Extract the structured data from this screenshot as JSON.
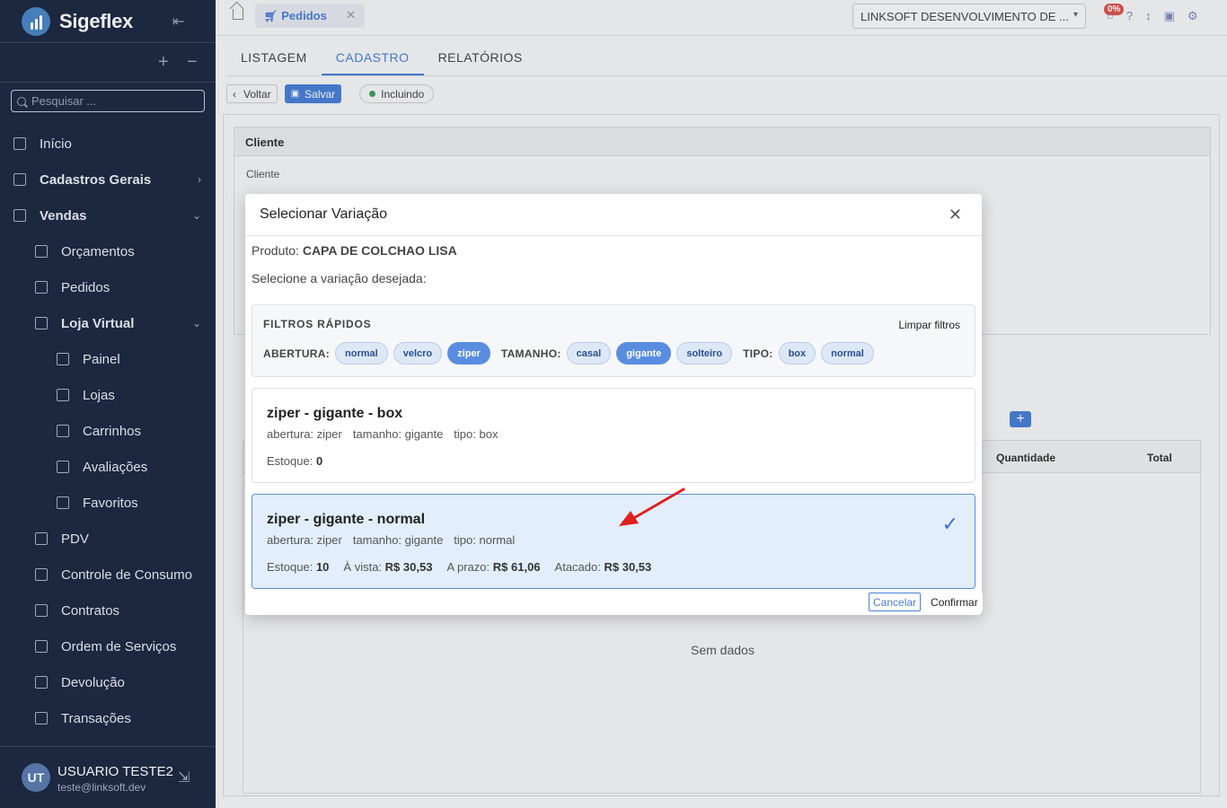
{
  "brand": {
    "name": "Sigeflex"
  },
  "sidebar": {
    "search_placeholder": "Pesquisar ...",
    "expand_label": "+",
    "collapse_label": "−",
    "items": [
      {
        "label": "Início",
        "icon": "home-icon"
      },
      {
        "label": "Cadastros Gerais",
        "icon": "grid-icon"
      },
      {
        "label": "Vendas",
        "icon": "bag-icon"
      },
      {
        "label": "Orçamentos",
        "icon": "edit-icon"
      },
      {
        "label": "Pedidos",
        "icon": "cart-icon"
      },
      {
        "label": "Loja Virtual",
        "icon": "store-icon"
      },
      {
        "label": "Painel",
        "icon": "dashboard-icon"
      },
      {
        "label": "Lojas",
        "icon": "shop-icon"
      },
      {
        "label": "Carrinhos",
        "icon": "cart-icon"
      },
      {
        "label": "Avaliações",
        "icon": "star-icon"
      },
      {
        "label": "Favoritos",
        "icon": "heart-icon"
      },
      {
        "label": "PDV",
        "icon": "monitor-icon"
      },
      {
        "label": "Controle de Consumo",
        "icon": "utensils-icon"
      },
      {
        "label": "Contratos",
        "icon": "document-icon"
      },
      {
        "label": "Ordem de Serviços",
        "icon": "tools-icon"
      },
      {
        "label": "Devolução",
        "icon": "undo-icon"
      },
      {
        "label": "Transações",
        "icon": "exchange-icon"
      }
    ]
  },
  "user": {
    "initials": "UT",
    "name": "USUARIO TESTE2",
    "email": "teste@linksoft.dev"
  },
  "topbar": {
    "tab_label": "Pedidos",
    "tab_close": "✕",
    "company": "LINKSOFT DESENVOLVIMENTO DE ...",
    "badge": "0%"
  },
  "subtabs": [
    "LISTAGEM",
    "CADASTRO",
    "RELATÓRIOS"
  ],
  "toolbar": {
    "back": "Voltar",
    "save": "Salvar",
    "status": "Incluindo"
  },
  "cliente": {
    "header": "Cliente",
    "label": "Cliente"
  },
  "grid": {
    "col_qty": "Quantidade",
    "col_total": "Total",
    "empty": "Sem dados"
  },
  "modal": {
    "title": "Selecionar Variação",
    "product_label": "Produto:",
    "product_name": "CAPA DE COLCHAO LISA",
    "instruction": "Selecione a variação desejada:",
    "filters_title": "FILTROS RÁPIDOS",
    "clear_filters": "Limpar filtros",
    "filter_groups": [
      {
        "label": "ABERTURA:",
        "options": [
          "normal",
          "velcro",
          "ziper"
        ],
        "selected": "ziper"
      },
      {
        "label": "TAMANHO:",
        "options": [
          "casal",
          "gigante",
          "solteiro"
        ],
        "selected": "gigante"
      },
      {
        "label": "TIPO:",
        "options": [
          "box",
          "normal"
        ],
        "selected": ""
      }
    ],
    "variations": [
      {
        "name": "ziper - gigante - box",
        "attrs": [
          "abertura: ziper",
          "tamanho: gigante",
          "tipo: box"
        ],
        "stock_label": "Estoque:",
        "stock": "0",
        "selected": false
      },
      {
        "name": "ziper - gigante - normal",
        "attrs": [
          "abertura: ziper",
          "tamanho: gigante",
          "tipo: normal"
        ],
        "stock_label": "Estoque:",
        "stock": "10",
        "cash_label": "À vista:",
        "cash": "R$ 30,53",
        "term_label": "A prazo:",
        "term": "R$ 61,06",
        "wholesale_label": "Atacado:",
        "wholesale": "R$ 30,53",
        "selected": true
      }
    ],
    "cancel": "Cancelar",
    "confirm": "Confirmar"
  },
  "colors": {
    "sidebar_bg": "#1e2a44",
    "accent": "#4a7fd6",
    "selected_card": "#e2eefb",
    "arrow": "#e01e1e"
  }
}
